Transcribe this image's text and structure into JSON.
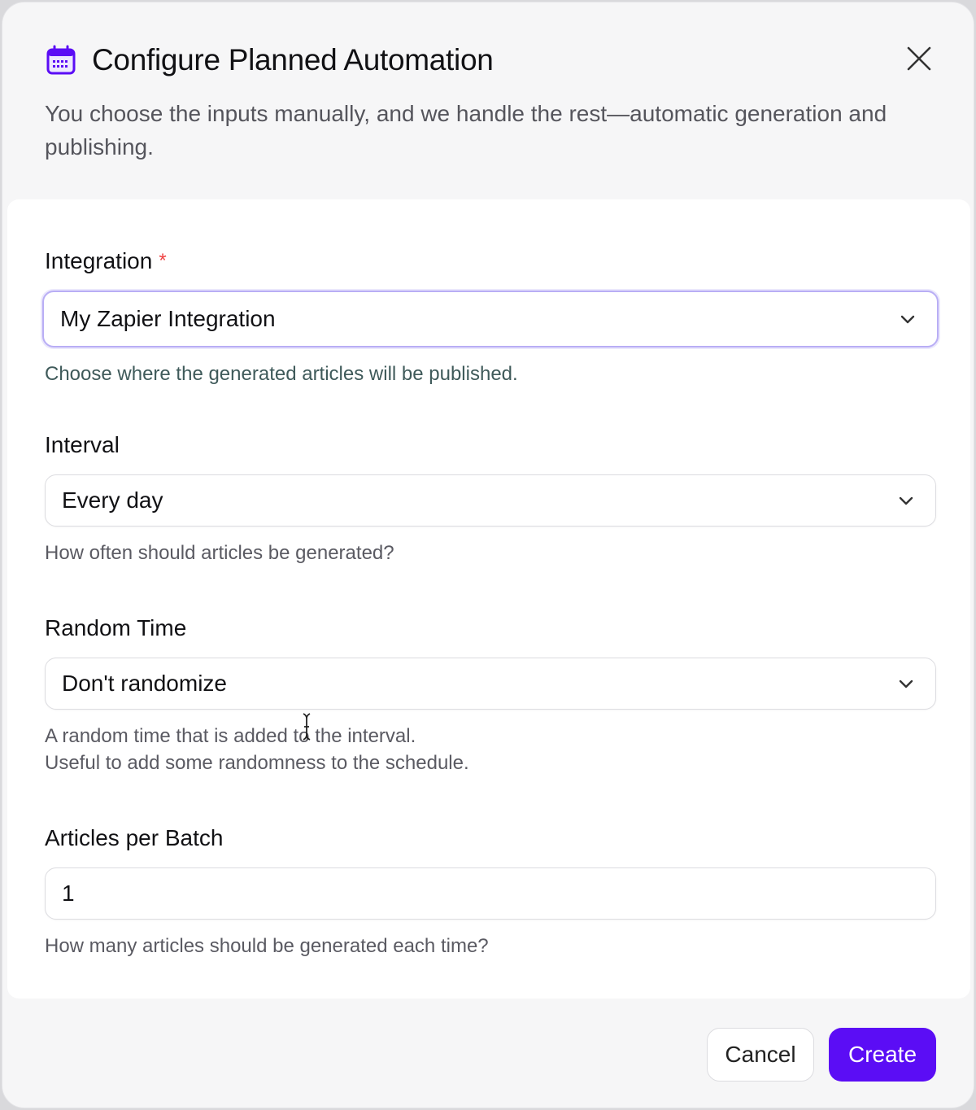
{
  "dialog": {
    "title": "Configure Planned Automation",
    "subtitle": "You choose the inputs manually, and we handle the rest—automatic generation and publishing.",
    "icon": "calendar-icon",
    "accent_color": "#5b0df5"
  },
  "fields": {
    "integration": {
      "label": "Integration",
      "required_mark": "*",
      "value": "My Zapier Integration",
      "help": "Choose where the generated articles will be published."
    },
    "interval": {
      "label": "Interval",
      "value": "Every day",
      "help": "How often should articles be generated?"
    },
    "random_time": {
      "label": "Random Time",
      "value": "Don't randomize",
      "help_line1": "A random time that is added to the interval.",
      "help_line2": "Useful to add some randomness to the schedule."
    },
    "articles_per_batch": {
      "label": "Articles per Batch",
      "value": "1",
      "help": "How many articles should be generated each time?"
    }
  },
  "footer": {
    "cancel_label": "Cancel",
    "create_label": "Create"
  }
}
